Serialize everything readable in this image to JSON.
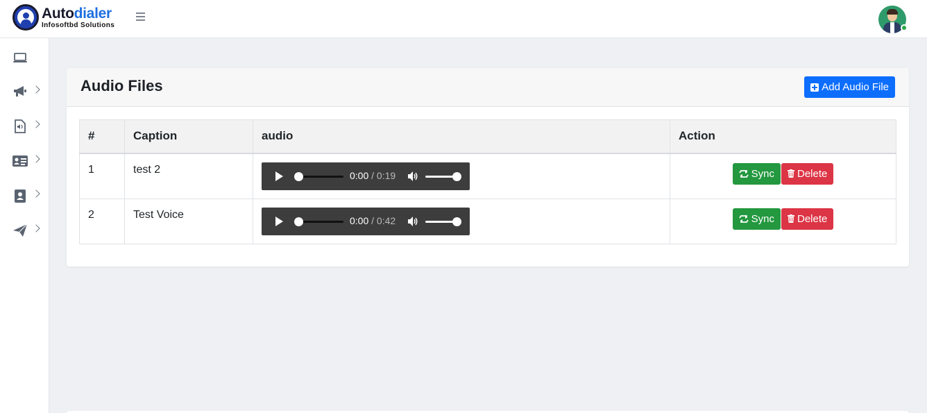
{
  "brand": {
    "name_part1": "Auto",
    "name_part2": "dialer",
    "subtitle": "Infosoftbd Solutions",
    "accent": "#1f6fe0"
  },
  "header": {
    "menu_icon": "hamburger-icon",
    "avatar_icon": "user-avatar",
    "status": "online"
  },
  "sidebar": {
    "items": [
      {
        "icon": "laptop-icon",
        "expandable": false
      },
      {
        "icon": "megaphone-icon",
        "expandable": true
      },
      {
        "icon": "audio-file-icon",
        "expandable": true
      },
      {
        "icon": "address-card-icon",
        "expandable": true
      },
      {
        "icon": "contact-book-icon",
        "expandable": true
      },
      {
        "icon": "paper-plane-icon",
        "expandable": true
      }
    ]
  },
  "card": {
    "title": "Audio Files",
    "add_button_label": "Add Audio File"
  },
  "table": {
    "headers": [
      "#",
      "Caption",
      "audio",
      "Action"
    ],
    "rows": [
      {
        "num": "1",
        "caption": "test 2",
        "current": "0:00",
        "duration": "/ 0:19",
        "sync_label": "Sync",
        "delete_label": "Delete"
      },
      {
        "num": "2",
        "caption": "Test Voice",
        "current": "0:00",
        "duration": "/ 0:42",
        "sync_label": "Sync",
        "delete_label": "Delete"
      }
    ]
  },
  "colors": {
    "primary": "#0d6efd",
    "success": "#23983f",
    "danger": "#dc3545",
    "background": "#eff0f4"
  }
}
